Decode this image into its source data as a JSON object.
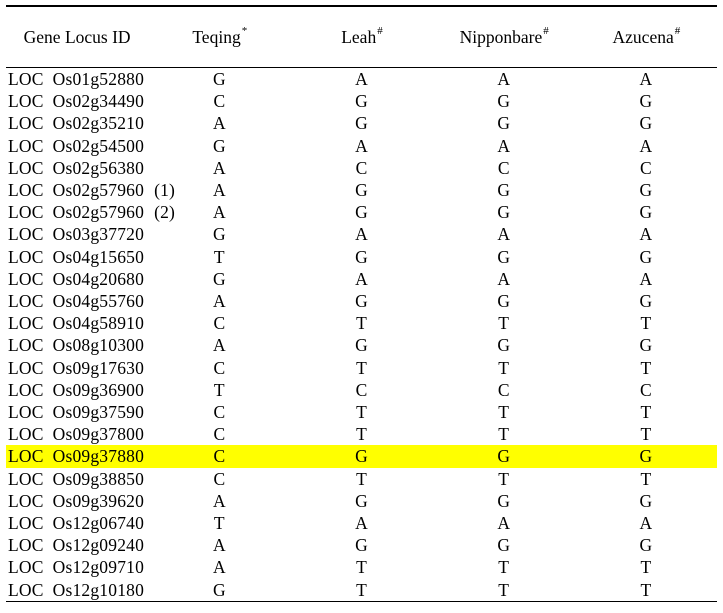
{
  "table": {
    "columns": [
      {
        "key": "gene",
        "label": "Gene  Locus  ID",
        "sup": ""
      },
      {
        "key": "teqing",
        "label": "Teqing",
        "sup": "*"
      },
      {
        "key": "leah",
        "label": "Leah",
        "sup": "#"
      },
      {
        "key": "nipponbare",
        "label": "Nipponbare",
        "sup": "#"
      },
      {
        "key": "azucena",
        "label": "Azucena",
        "sup": "#"
      }
    ],
    "highlight_color": "#ffff00",
    "highlighted_gene": "LOC Os09g37880",
    "rows": [
      {
        "prefix": "LOC",
        "locus": "Os01g52880",
        "suffix": "",
        "teqing": "G",
        "leah": "A",
        "nipponbare": "A",
        "azucena": "A",
        "highlight": false
      },
      {
        "prefix": "LOC",
        "locus": "Os02g34490",
        "suffix": "",
        "teqing": "C",
        "leah": "G",
        "nipponbare": "G",
        "azucena": "G",
        "highlight": false
      },
      {
        "prefix": "LOC",
        "locus": "Os02g35210",
        "suffix": "",
        "teqing": "A",
        "leah": "G",
        "nipponbare": "G",
        "azucena": "G",
        "highlight": false
      },
      {
        "prefix": "LOC",
        "locus": "Os02g54500",
        "suffix": "",
        "teqing": "G",
        "leah": "A",
        "nipponbare": "A",
        "azucena": "A",
        "highlight": false
      },
      {
        "prefix": "LOC",
        "locus": "Os02g56380",
        "suffix": "",
        "teqing": "A",
        "leah": "C",
        "nipponbare": "C",
        "azucena": "C",
        "highlight": false
      },
      {
        "prefix": "LOC",
        "locus": "Os02g57960",
        "suffix": "(1)",
        "teqing": "A",
        "leah": "G",
        "nipponbare": "G",
        "azucena": "G",
        "highlight": false
      },
      {
        "prefix": "LOC",
        "locus": "Os02g57960",
        "suffix": "(2)",
        "teqing": "A",
        "leah": "G",
        "nipponbare": "G",
        "azucena": "G",
        "highlight": false
      },
      {
        "prefix": "LOC",
        "locus": "Os03g37720",
        "suffix": "",
        "teqing": "G",
        "leah": "A",
        "nipponbare": "A",
        "azucena": "A",
        "highlight": false
      },
      {
        "prefix": "LOC",
        "locus": "Os04g15650",
        "suffix": "",
        "teqing": "T",
        "leah": "G",
        "nipponbare": "G",
        "azucena": "G",
        "highlight": false
      },
      {
        "prefix": "LOC",
        "locus": "Os04g20680",
        "suffix": "",
        "teqing": "G",
        "leah": "A",
        "nipponbare": "A",
        "azucena": "A",
        "highlight": false
      },
      {
        "prefix": "LOC",
        "locus": "Os04g55760",
        "suffix": "",
        "teqing": "A",
        "leah": "G",
        "nipponbare": "G",
        "azucena": "G",
        "highlight": false
      },
      {
        "prefix": "LOC",
        "locus": "Os04g58910",
        "suffix": "",
        "teqing": "C",
        "leah": "T",
        "nipponbare": "T",
        "azucena": "T",
        "highlight": false
      },
      {
        "prefix": "LOC",
        "locus": "Os08g10300",
        "suffix": "",
        "teqing": "A",
        "leah": "G",
        "nipponbare": "G",
        "azucena": "G",
        "highlight": false
      },
      {
        "prefix": "LOC",
        "locus": "Os09g17630",
        "suffix": "",
        "teqing": "C",
        "leah": "T",
        "nipponbare": "T",
        "azucena": "T",
        "highlight": false
      },
      {
        "prefix": "LOC",
        "locus": "Os09g36900",
        "suffix": "",
        "teqing": "T",
        "leah": "C",
        "nipponbare": "C",
        "azucena": "C",
        "highlight": false
      },
      {
        "prefix": "LOC",
        "locus": "Os09g37590",
        "suffix": "",
        "teqing": "C",
        "leah": "T",
        "nipponbare": "T",
        "azucena": "T",
        "highlight": false
      },
      {
        "prefix": "LOC",
        "locus": "Os09g37800",
        "suffix": "",
        "teqing": "C",
        "leah": "T",
        "nipponbare": "T",
        "azucena": "T",
        "highlight": false
      },
      {
        "prefix": "LOC",
        "locus": "Os09g37880",
        "suffix": "",
        "teqing": "C",
        "leah": "G",
        "nipponbare": "G",
        "azucena": "G",
        "highlight": true
      },
      {
        "prefix": "LOC",
        "locus": "Os09g38850",
        "suffix": "",
        "teqing": "C",
        "leah": "T",
        "nipponbare": "T",
        "azucena": "T",
        "highlight": false
      },
      {
        "prefix": "LOC",
        "locus": "Os09g39620",
        "suffix": "",
        "teqing": "A",
        "leah": "G",
        "nipponbare": "G",
        "azucena": "G",
        "highlight": false
      },
      {
        "prefix": "LOC",
        "locus": "Os12g06740",
        "suffix": "",
        "teqing": "T",
        "leah": "A",
        "nipponbare": "A",
        "azucena": "A",
        "highlight": false
      },
      {
        "prefix": "LOC",
        "locus": "Os12g09240",
        "suffix": "",
        "teqing": "A",
        "leah": "G",
        "nipponbare": "G",
        "azucena": "G",
        "highlight": false
      },
      {
        "prefix": "LOC",
        "locus": "Os12g09710",
        "suffix": "",
        "teqing": "A",
        "leah": "T",
        "nipponbare": "T",
        "azucena": "T",
        "highlight": false
      },
      {
        "prefix": "LOC",
        "locus": "Os12g10180",
        "suffix": "",
        "teqing": "G",
        "leah": "T",
        "nipponbare": "T",
        "azucena": "T",
        "highlight": false
      }
    ]
  }
}
